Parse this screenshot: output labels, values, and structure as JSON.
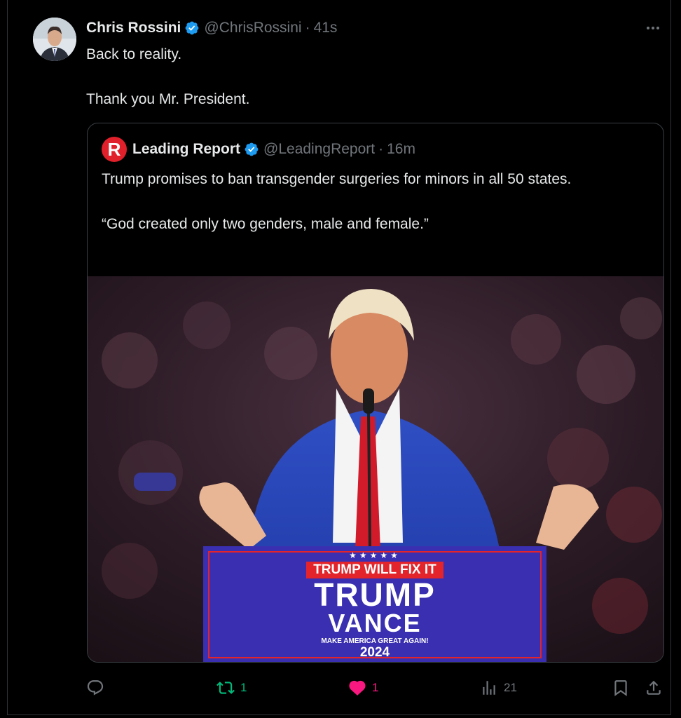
{
  "author": {
    "name": "Chris Rossini",
    "handle": "@ChrisRossini",
    "time": "41s",
    "separator": "·"
  },
  "tweet": {
    "lines": [
      "Back to reality.",
      "Thank you Mr. President."
    ]
  },
  "quoted": {
    "name": "Leading Report",
    "logo_letter": "R",
    "handle": "@LeadingReport",
    "time": "16m",
    "separator": "·",
    "lines": [
      "Trump promises to ban transgender surgeries for minors in all 50 states.",
      "“God created only two genders, male and female.”"
    ]
  },
  "podium": {
    "stars": "★★★★★",
    "banner": "TRUMP WILL FIX IT",
    "line1": "TRUMP",
    "line2": "VANCE",
    "slogan": "MAKE AMERICA GREAT AGAIN!",
    "year": "2024"
  },
  "actions": {
    "reply_count": "",
    "retweet_count": "1",
    "like_count": "1",
    "views_count": "21"
  },
  "icons": {
    "reply": "reply-icon",
    "retweet": "retweet-icon",
    "like": "heart-icon",
    "views": "views-icon",
    "bookmark": "bookmark-icon",
    "share": "share-icon",
    "more": "more-icon",
    "verified": "verified-badge-icon"
  },
  "colors": {
    "background": "#000000",
    "text": "#e7e9ea",
    "muted": "#71767b",
    "verified": "#1d9bf0",
    "retweet": "#00ba7c",
    "like": "#f91880",
    "podium": "#3a2fb0",
    "banner": "#e3242b"
  }
}
